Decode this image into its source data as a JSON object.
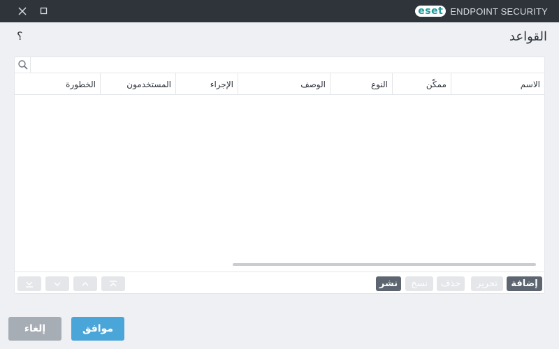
{
  "window": {
    "brand_logo": "eset",
    "product_name": "ENDPOINT SECURITY",
    "close_icon": "close-icon",
    "maximize_icon": "maximize-icon"
  },
  "page": {
    "title": "القواعد",
    "help_label": "؟"
  },
  "search": {
    "value": "",
    "placeholder": "",
    "icon": "search-icon"
  },
  "table": {
    "columns": [
      "الاسم",
      "ممكّن",
      "النوع",
      "الوصف",
      "الإجراء",
      "المستخدمون",
      "الخطورة"
    ],
    "rows": []
  },
  "actions": {
    "add": "إضافة",
    "edit": "تحرير",
    "delete": "حذف",
    "copy": "نسخ",
    "publish": "نشر"
  },
  "nav_icons": [
    "move-bottom-icon",
    "move-down-icon",
    "move-up-icon",
    "move-top-icon"
  ],
  "footer": {
    "ok": "موافق",
    "cancel": "إلغاء"
  },
  "colors": {
    "titlebar": "#2f343b",
    "accent": "#4aa6d8",
    "brand": "#1e9a96",
    "button_active": "#5d6570",
    "button_disabled": "#e4e6e9",
    "cancel": "#a7adb5"
  }
}
